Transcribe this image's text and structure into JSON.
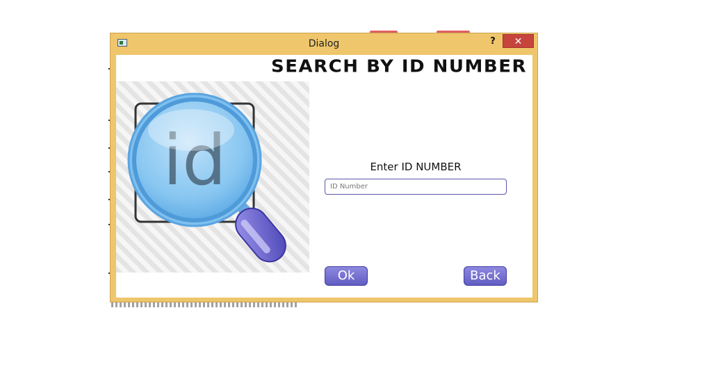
{
  "window": {
    "title": "Dialog",
    "help_label": "?",
    "close_label": "✕"
  },
  "content": {
    "heading": "SEARCH BY ID NUMBER",
    "image_text": "id",
    "field_label": "Enter ID NUMBER",
    "input_placeholder": "ID Number",
    "input_value": ""
  },
  "buttons": {
    "ok_label": "Ok",
    "back_label": "Back"
  },
  "colors": {
    "frame": "#efc66b",
    "close": "#c7443d",
    "button": "#6f6ad0",
    "input_border": "#5a57a8",
    "lens": "#7ec0ef"
  }
}
